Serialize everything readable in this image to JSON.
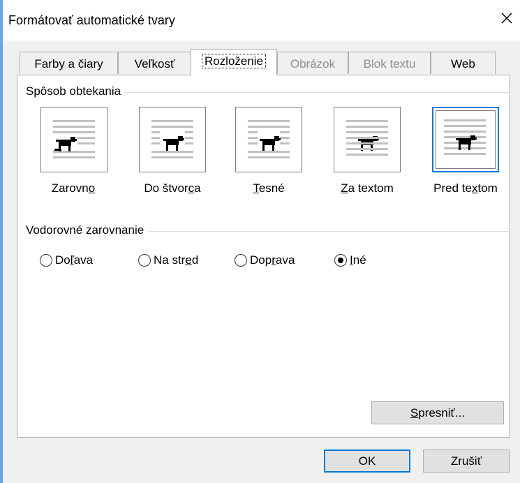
{
  "dialog": {
    "title": "Formátovať automatické tvary"
  },
  "tabs": [
    {
      "label": "Farby a čiary",
      "state": "enabled"
    },
    {
      "label": "Veľkosť",
      "state": "enabled"
    },
    {
      "label": "Rozloženie",
      "state": "active"
    },
    {
      "label": "Obrázok",
      "state": "disabled"
    },
    {
      "label": "Blok textu",
      "state": "disabled"
    },
    {
      "label": "Web",
      "state": "enabled"
    }
  ],
  "wrapping": {
    "group_label": "Spôsob obtekania",
    "options": [
      {
        "label_pre": "Zarovn",
        "label_mnemonic": "o",
        "label_post": "",
        "icon": "wrap-inline-icon"
      },
      {
        "label_pre": "Do štvor",
        "label_mnemonic": "c",
        "label_post": "a",
        "icon": "wrap-square-icon"
      },
      {
        "label_pre": "",
        "label_mnemonic": "T",
        "label_post": "esné",
        "icon": "wrap-tight-icon"
      },
      {
        "label_pre": "",
        "label_mnemonic": "Z",
        "label_post": "a textom",
        "icon": "wrap-behind-text-icon"
      },
      {
        "label_pre": "Pred te",
        "label_mnemonic": "x",
        "label_post": "tom",
        "icon": "wrap-in-front-icon"
      }
    ],
    "selected": "Pred textom"
  },
  "horizontal_alignment": {
    "group_label": "Vodorovné zarovnanie",
    "options": [
      {
        "label_pre": "Do",
        "label_mnemonic": "ľ",
        "label_post": "ava",
        "checked": false
      },
      {
        "label_pre": "Na str",
        "label_mnemonic": "e",
        "label_post": "d",
        "checked": false
      },
      {
        "label_pre": "Dop",
        "label_mnemonic": "r",
        "label_post": "ava",
        "checked": false
      },
      {
        "label_pre": "",
        "label_mnemonic": "I",
        "label_post": "né",
        "checked": true
      }
    ]
  },
  "buttons": {
    "advanced_mnemonic": "S",
    "advanced_rest": "presniť...",
    "ok": "OK",
    "cancel": "Zrušiť"
  },
  "colors": {
    "window_border": "#6aa7e0",
    "selection_blue": "#0078d7",
    "disabled_text": "#8e8e8e"
  }
}
